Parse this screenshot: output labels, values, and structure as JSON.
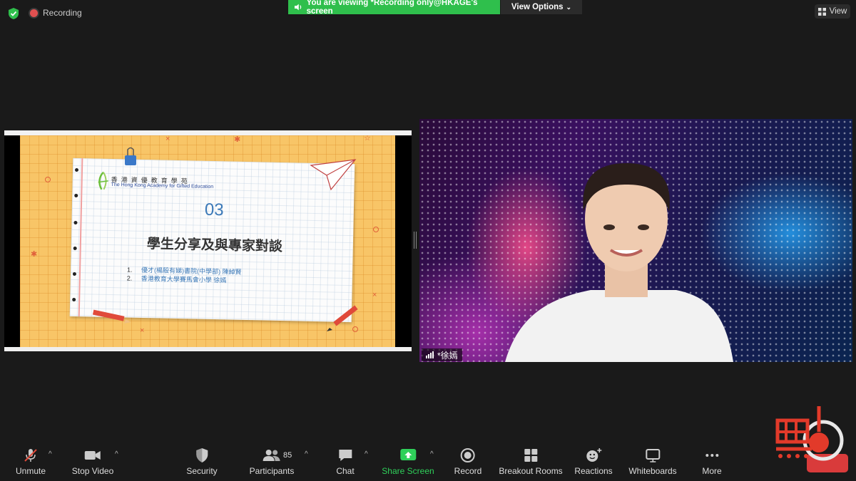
{
  "top_bar": {
    "recording_label": "Recording",
    "viewing_banner": "You are viewing *Recording only@HKAGE's screen",
    "view_options_label": "View Options",
    "view_label": "View"
  },
  "slide": {
    "org_name_zh": "香港資優教育學苑",
    "org_name_en": "The Hong Kong Academy for Gifted Education",
    "section_number": "03",
    "title": "學生分享及與專家對談",
    "items": [
      {
        "num": "1.",
        "text": "優才(楊殷有娣)書院(中學部) 陳綽賢"
      },
      {
        "num": "2.",
        "text": "香港教育大學賽馬會小學 徐嫣"
      }
    ]
  },
  "participant": {
    "name": "*徐嫣"
  },
  "toolbar": {
    "items": [
      {
        "label": "Unmute",
        "icon": "microphone-muted-icon"
      },
      {
        "label": "Stop Video",
        "icon": "video-camera-icon"
      },
      {
        "label": "Security",
        "icon": "shield-icon"
      },
      {
        "label": "Participants",
        "icon": "participants-icon"
      },
      {
        "label": "Chat",
        "icon": "chat-bubble-icon"
      },
      {
        "label": "Share Screen",
        "icon": "share-screen-icon"
      },
      {
        "label": "Record",
        "icon": "record-icon"
      },
      {
        "label": "Breakout Rooms",
        "icon": "breakout-rooms-icon"
      },
      {
        "label": "Reactions",
        "icon": "reactions-icon"
      },
      {
        "label": "Whiteboards",
        "icon": "whiteboard-icon"
      },
      {
        "label": "More",
        "icon": "more-dots-icon"
      }
    ],
    "participants_count": "85"
  },
  "colors": {
    "banner_green": "#2fbf4c",
    "share_green": "#2fd05a",
    "end_red": "#d93b3b",
    "toolbar_bg": "#1a1a1a"
  }
}
